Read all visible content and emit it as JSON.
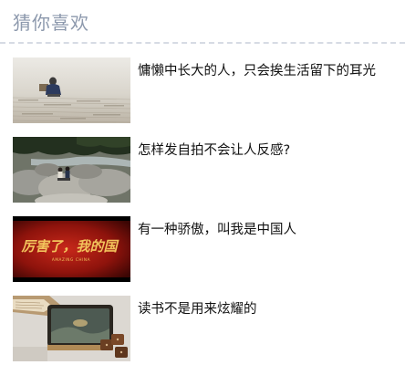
{
  "section": {
    "title": "猜你喜欢"
  },
  "items": [
    {
      "title": "慵懒中长大的人，只会挨生活留下的耳光",
      "thumb": "person-reading-on-book-thumbnail"
    },
    {
      "title": "怎样发自拍不会让人反感?",
      "thumb": "couple-on-rocks-thumbnail"
    },
    {
      "title": "有一种骄傲，叫我是中国人",
      "thumb": "amazing-china-poster-thumbnail"
    },
    {
      "title": "读书不是用来炫耀的",
      "thumb": "book-and-mahjong-thumbnail"
    }
  ],
  "thumb_texts": {
    "poster_calligraphy": "厉害了，我的国",
    "poster_subtitle": "AMAZING CHINA"
  },
  "colors": {
    "section_title": "#8d99ad",
    "divider": "#d6dbe4",
    "item_title": "#111111"
  }
}
